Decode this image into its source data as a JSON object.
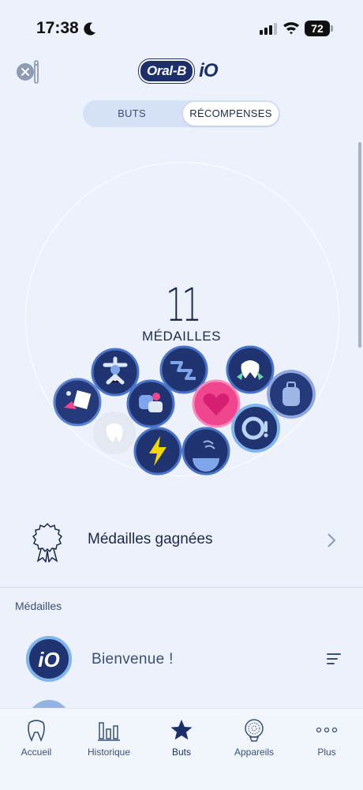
{
  "status": {
    "time": "17:38",
    "battery": "72"
  },
  "header": {
    "logo_brand": "Oral-B",
    "logo_product": "iO"
  },
  "segment": {
    "tabs": [
      {
        "label": "BUTS",
        "active": false
      },
      {
        "label": "RÉCOMPENSES",
        "active": true
      }
    ]
  },
  "medals": {
    "count": "11",
    "label": "MÉDAILLES"
  },
  "won": {
    "label": "Médailles gagnées"
  },
  "section": {
    "title": "Médailles"
  },
  "list": {
    "items": [
      {
        "label": "Bienvenue !"
      }
    ]
  },
  "tabbar": {
    "items": [
      {
        "label": "Accueil",
        "icon": "tooth-icon"
      },
      {
        "label": "Historique",
        "icon": "bar-chart-icon"
      },
      {
        "label": "Buts",
        "icon": "star-icon"
      },
      {
        "label": "Appareils",
        "icon": "brush-head-icon"
      },
      {
        "label": "Plus",
        "icon": "more-icon"
      }
    ],
    "active": "Buts"
  },
  "colors": {
    "background": "#ecf1fb",
    "navy": "#1c2f6b",
    "accent_pink": "#f0468f",
    "accent_blue": "#4a90e2"
  }
}
